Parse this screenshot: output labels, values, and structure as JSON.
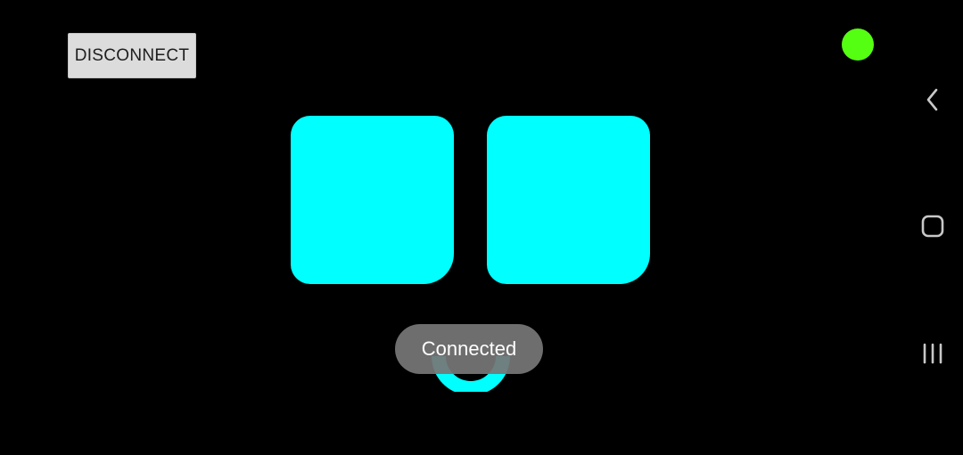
{
  "buttons": {
    "disconnect_label": "DISCONNECT"
  },
  "toast": {
    "text": "Connected"
  },
  "colors": {
    "background": "#000000",
    "face": "#00ffff",
    "status_connected": "#55ff11",
    "nav_icon": "#c8c8c8"
  },
  "status": {
    "connected": true
  },
  "navigation_bar": {
    "icons": [
      "back-icon",
      "home-icon",
      "recents-icon"
    ]
  }
}
